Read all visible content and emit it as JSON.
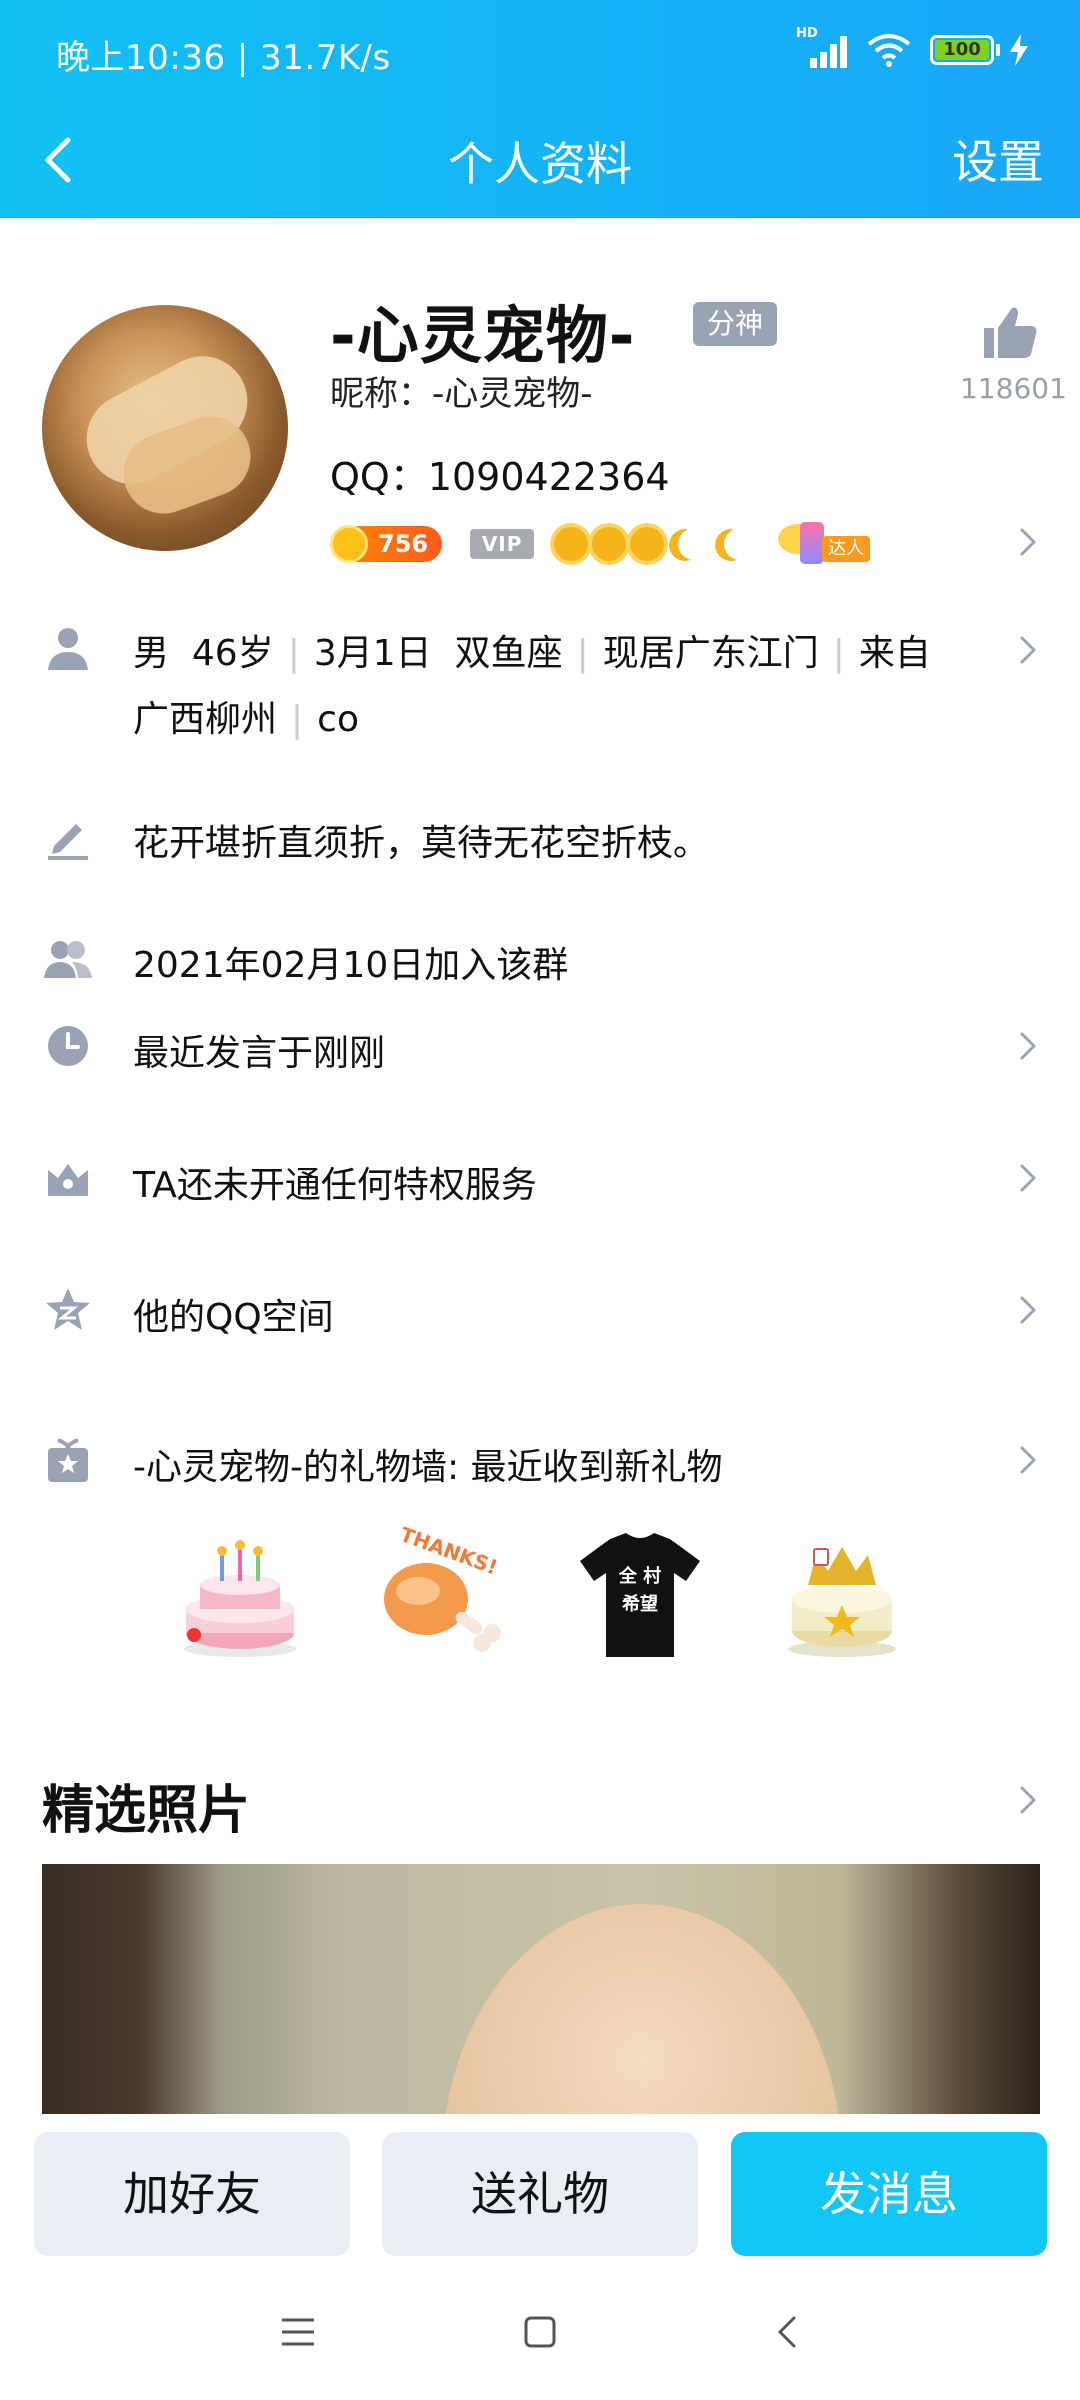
{
  "status_bar": {
    "time_speed": "晚上10:36 | 31.7K/s",
    "network_badge": "HD",
    "battery": "100"
  },
  "header": {
    "title": "个人资料",
    "settings_label": "设置"
  },
  "profile": {
    "display_name": "-心灵宠物-",
    "role_tag": "分神",
    "nickname": "昵称：-心灵宠物-",
    "qq": "QQ：1090422364",
    "likes": "118601",
    "coin_level": "756",
    "vip": "VIP",
    "expert_label": "达人"
  },
  "info": {
    "line1": [
      "男",
      "46岁",
      "3月1日",
      "双鱼座",
      "现居广东江门",
      "来自"
    ],
    "line2": [
      "广西柳州",
      "co"
    ]
  },
  "rows": {
    "signature": "花开堪折直须折，莫待无花空折枝。",
    "join_date": "2021年02月10日加入该群",
    "last_speak": "最近发言于刚刚",
    "privilege": "TA还未开通任何特权服务",
    "qzone": "他的QQ空间",
    "gift_wall": "-心灵宠物-的礼物墙: 最近收到新礼物"
  },
  "gifts": {
    "tshirt_line1": "全 村",
    "tshirt_line2": "希望",
    "drumstick_text": "THANKS!"
  },
  "photos": {
    "title": "精选照片"
  },
  "actions": {
    "add_friend": "加好友",
    "send_gift": "送礼物",
    "send_message": "发消息"
  },
  "colors": {
    "header_start": "#12c1f4",
    "header_end": "#1aa7f8",
    "primary_button": "#12c7f5",
    "secondary_button": "#e9edf4",
    "icon_gray": "#9aa3b3"
  }
}
